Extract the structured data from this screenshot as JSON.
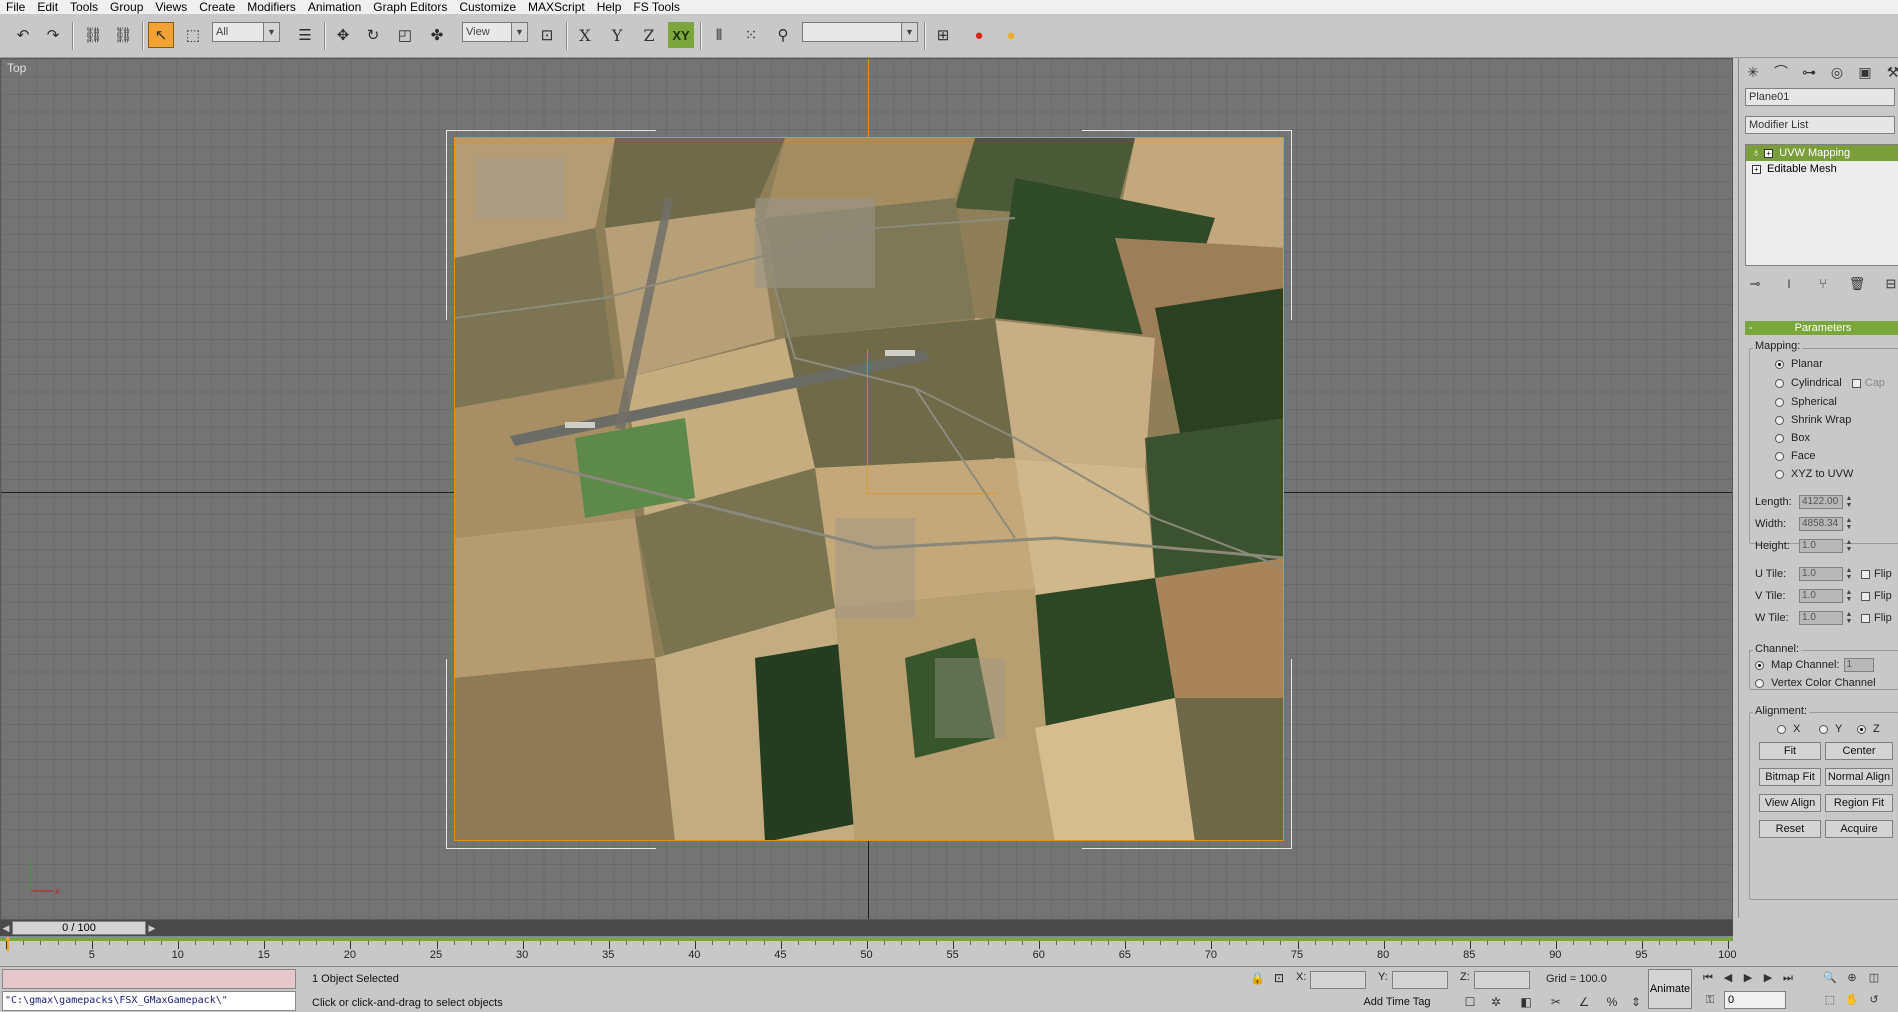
{
  "menu": [
    "File",
    "Edit",
    "Tools",
    "Group",
    "Views",
    "Create",
    "Modifiers",
    "Animation",
    "Graph Editors",
    "Customize",
    "MAXScript",
    "Help",
    "FS Tools"
  ],
  "toolbar": {
    "selection_filter": "All",
    "ref_coord": "View",
    "named_selection": "",
    "axis_x": "X",
    "axis_y": "Y",
    "axis_z": "Z",
    "axis_xy": "XY"
  },
  "viewport": {
    "label": "Top"
  },
  "command_panel": {
    "object_name": "Plane01",
    "modifier_list": "Modifier List",
    "stack": [
      "UVW Mapping",
      "Editable Mesh"
    ],
    "rollout_title": "Parameters",
    "mapping_label": "Mapping:",
    "mapping_options": [
      "Planar",
      "Cylindrical",
      "Spherical",
      "Shrink Wrap",
      "Box",
      "Face",
      "XYZ to UVW"
    ],
    "mapping_selected": "Planar",
    "cap_label": "Cap",
    "length_label": "Length:",
    "length_value": "4122.00",
    "width_label": "Width:",
    "width_value": "4858.34",
    "height_label": "Height:",
    "height_value": "1.0",
    "u_tile_label": "U Tile:",
    "u_tile_value": "1.0",
    "v_tile_label": "V Tile:",
    "v_tile_value": "1.0",
    "w_tile_label": "W Tile:",
    "w_tile_value": "1.0",
    "flip_label": "Flip",
    "channel_label": "Channel:",
    "map_channel_label": "Map Channel:",
    "map_channel_value": "1",
    "vertex_color_label": "Vertex Color Channel",
    "alignment_label": "Alignment:",
    "align_x": "X",
    "align_y": "Y",
    "align_z": "Z",
    "buttons": {
      "fit": "Fit",
      "center": "Center",
      "bitmap_fit": "Bitmap Fit",
      "normal_align": "Normal Align",
      "view_align": "View Align",
      "region_fit": "Region Fit",
      "reset": "Reset",
      "acquire": "Acquire"
    }
  },
  "timeline": {
    "frame_display": "0 / 100",
    "ruler_labels": [
      "5",
      "10",
      "15",
      "20",
      "25",
      "30",
      "35",
      "40",
      "45",
      "50",
      "55",
      "60",
      "65",
      "70",
      "75",
      "80",
      "85",
      "90",
      "95",
      "100"
    ]
  },
  "status": {
    "maxscript_path": "\"C:\\gmax\\gamepacks\\FSX_GMaxGamepack\\\"",
    "selection_text": "1 Object Selected",
    "prompt_text": "Click or click-and-drag to select objects",
    "x_label": "X:",
    "y_label": "Y:",
    "z_label": "Z:",
    "grid_text": "Grid = 100.0",
    "animate_label": "Animate",
    "add_time_tag": "Add Time Tag",
    "current_frame": "0"
  }
}
